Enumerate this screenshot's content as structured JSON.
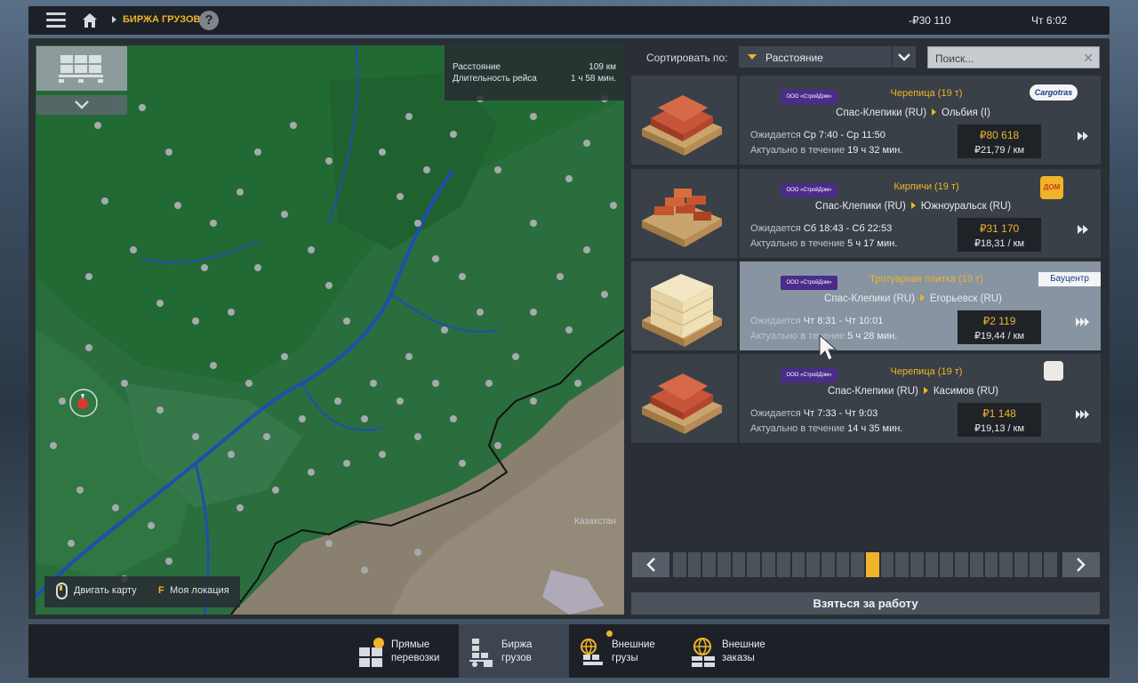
{
  "header": {
    "breadcrumb": "БИРЖА ГРУЗОВ",
    "help": "?",
    "money": "-₽30 110",
    "time": "Чт 6:02"
  },
  "map": {
    "route_distance_label": "Расстояние",
    "route_distance_value": "109 км",
    "route_duration_label": "Длительность рейса",
    "route_duration_value": "1 ч 58 мин.",
    "country_label": "Казахстан",
    "move_map_label": "Двигать карту",
    "my_location_key": "F",
    "my_location_label": "Моя локация"
  },
  "sort": {
    "label": "Сортировать по:",
    "selected": "Расстояние",
    "search_placeholder": "Поиск..."
  },
  "jobs": [
    {
      "company": "ООО «СтройДом»",
      "cargo": "Черепица (19 т)",
      "from": "Спас-Клепики (RU)",
      "to": "Ольбия (I)",
      "expected_label": "Ожидается",
      "expected": "Ср 7:40 - Ср 11:50",
      "valid_label": "Актуально в течение",
      "valid": "19 ч 32 мин.",
      "price": "₽80 618",
      "price_per_km": "₽21,79 / км",
      "logo": "Cargotras"
    },
    {
      "company": "ООО «СтройДом»",
      "cargo": "Кирпичи (19 т)",
      "from": "Спас-Клепики (RU)",
      "to": "Южноуральск (RU)",
      "expected_label": "Ожидается",
      "expected": "Сб 18:43 - Сб 22:53",
      "valid_label": "Актуально в течение",
      "valid": "5 ч 17 мин.",
      "price": "₽31 170",
      "price_per_km": "₽18,31 / км",
      "logo": "ДОМ"
    },
    {
      "company": "ООО «СтройДом»",
      "cargo": "Тротуарная плитка (19 т)",
      "from": "Спас-Клепики (RU)",
      "to": "Егорьевск (RU)",
      "expected_label": "Ожидается",
      "expected": "Чт 8:31 - Чт 10:01",
      "valid_label": "Актуально в течение",
      "valid": "5 ч 28 мин.",
      "price": "₽2 119",
      "price_per_km": "₽19,44 / км",
      "logo": "Бауцентр"
    },
    {
      "company": "ООО «СтройДом»",
      "cargo": "Черепица (19 т)",
      "from": "Спас-Клепики (RU)",
      "to": "Касимов (RU)",
      "expected_label": "Ожидается",
      "expected": "Чт 7:33 - Чт 9:03",
      "valid_label": "Актуально в течение",
      "valid": "14 ч 35 мин.",
      "price": "₽1 148",
      "price_per_km": "₽19,13 / км",
      "logo": ""
    }
  ],
  "pager": {
    "total_pages": 26,
    "current_page": 14
  },
  "take_job": "Взяться за работу",
  "tabs": [
    {
      "label1": "Прямые",
      "label2": "перевозки"
    },
    {
      "label1": "Биржа",
      "label2": "грузов"
    },
    {
      "label1": "Внешние",
      "label2": "грузы"
    },
    {
      "label1": "Внешние",
      "label2": "заказы"
    }
  ],
  "colors": {
    "accent": "#f0b429",
    "panel": "#2a2f36",
    "card": "#3a4047",
    "card_selected": "#8894a2",
    "forest": "#2a6e3e",
    "steppe": "#8a8070"
  }
}
